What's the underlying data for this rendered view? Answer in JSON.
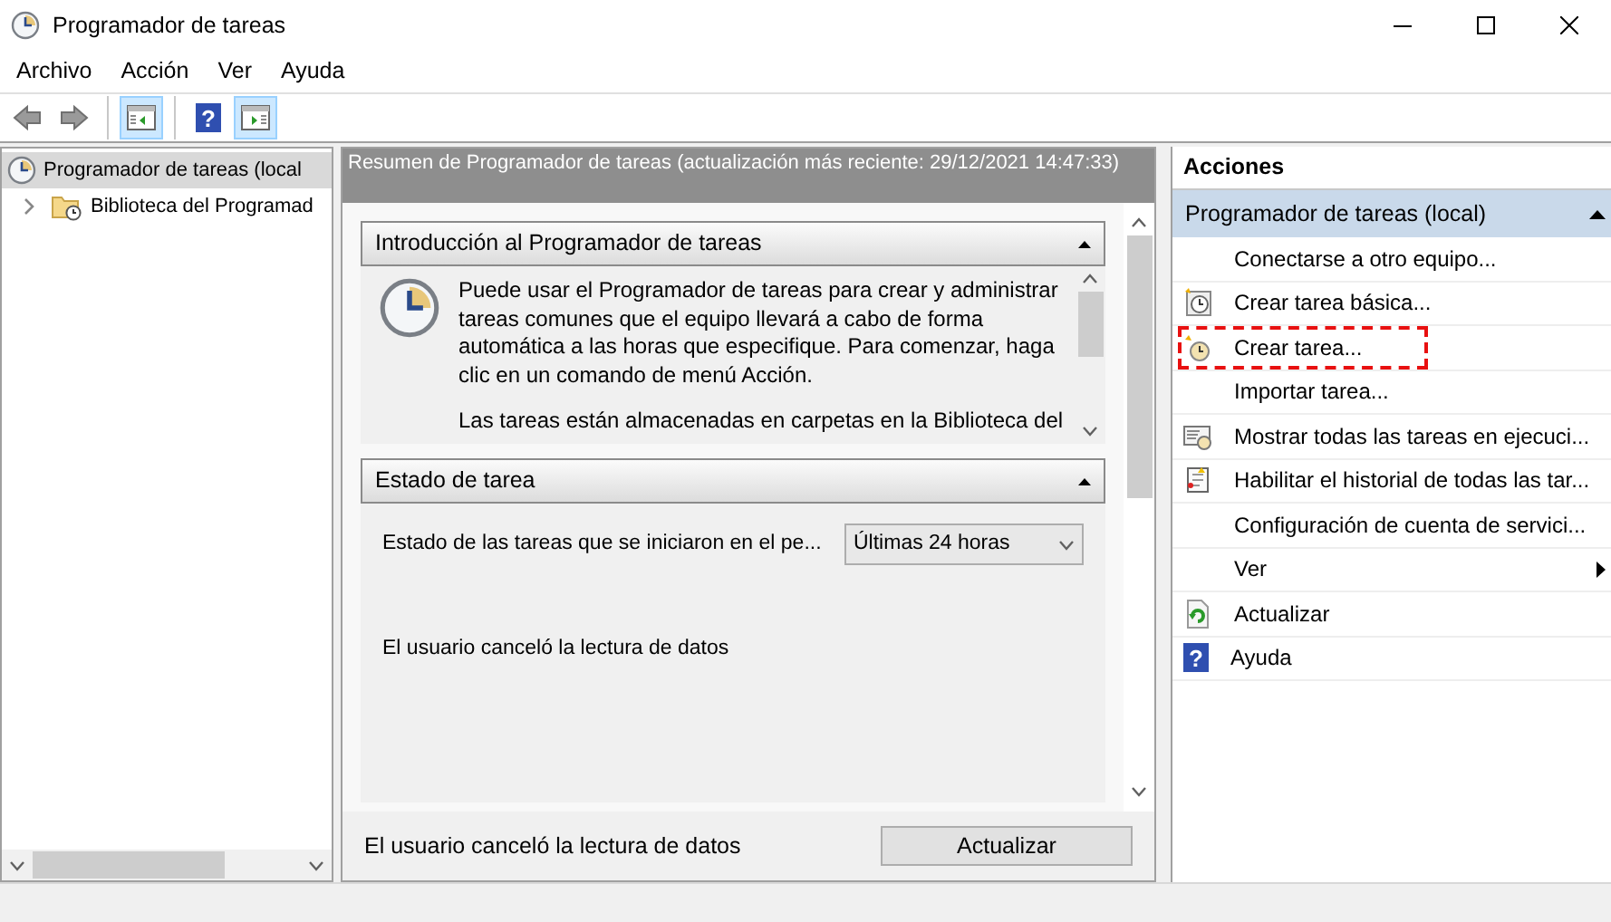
{
  "window": {
    "title": "Programador de tareas"
  },
  "menu": [
    "Archivo",
    "Acción",
    "Ver",
    "Ayuda"
  ],
  "toolbar": [
    {
      "kind": "back",
      "disabled": true
    },
    {
      "kind": "forward",
      "disabled": true
    },
    {
      "kind": "sep"
    },
    {
      "kind": "tree-pane",
      "selected": true
    },
    {
      "kind": "sep"
    },
    {
      "kind": "help",
      "glyph": "?",
      "selected": false
    },
    {
      "kind": "action-pane",
      "selected": true
    }
  ],
  "tree": [
    {
      "label": "Programador de tareas (local",
      "selected": true,
      "kind": "clock",
      "children": [
        {
          "label": "Biblioteca del Programad",
          "selected": false,
          "kind": "folder-clock",
          "expanded": false
        }
      ]
    }
  ],
  "summary": {
    "header": "Resumen de Programador de tareas (actualización más reciente: 29/12/2021 14:47:33)",
    "sections": [
      {
        "kind": "intro",
        "title": "Introducción al Programador de tareas",
        "expanded": true,
        "paragraphs": [
          "Puede usar el Programador de tareas para crear y administrar tareas comunes que el equipo llevará a cabo de forma automática a las horas que especifique. Para comenzar, haga clic en un comando de menú Acción.",
          "Las tareas están almacenadas en carpetas en la Biblioteca del"
        ]
      },
      {
        "kind": "status",
        "title": "Estado de tarea",
        "expanded": true,
        "filter_label": "Estado de las tareas que se iniciaron en el pe...",
        "filter_value": "Últimas 24 horas",
        "message": "El usuario canceló la lectura de datos"
      }
    ],
    "footer_message": "El usuario canceló la lectura de datos",
    "refresh_button": "Actualizar"
  },
  "actions": {
    "title": "Acciones",
    "group": "Programador de tareas (local)",
    "expanded": true,
    "items": [
      {
        "label": "Conectarse a otro equipo...",
        "kind": "plain",
        "highlighted": false,
        "submenu": false
      },
      {
        "label": "Crear tarea básica...",
        "kind": "clock-star",
        "highlighted": false,
        "submenu": false
      },
      {
        "label": "Crear tarea...",
        "kind": "clock-spark",
        "highlighted": true,
        "submenu": false
      },
      {
        "label": "Importar tarea...",
        "kind": "plain",
        "highlighted": false,
        "submenu": false
      },
      {
        "label": "Mostrar todas las tareas en ejecuci...",
        "kind": "list-clock",
        "highlighted": false,
        "submenu": false
      },
      {
        "label": "Habilitar el historial de todas las tar...",
        "kind": "notebook",
        "highlighted": false,
        "submenu": false
      },
      {
        "label": "Configuración de cuenta de servici...",
        "kind": "plain",
        "highlighted": false,
        "submenu": false
      },
      {
        "label": "Ver",
        "kind": "plain",
        "highlighted": false,
        "submenu": true
      },
      {
        "label": "Actualizar",
        "kind": "refresh",
        "highlighted": false,
        "submenu": false
      },
      {
        "label": "Ayuda",
        "kind": "help",
        "glyph": "?",
        "highlighted": false,
        "submenu": false
      }
    ]
  }
}
